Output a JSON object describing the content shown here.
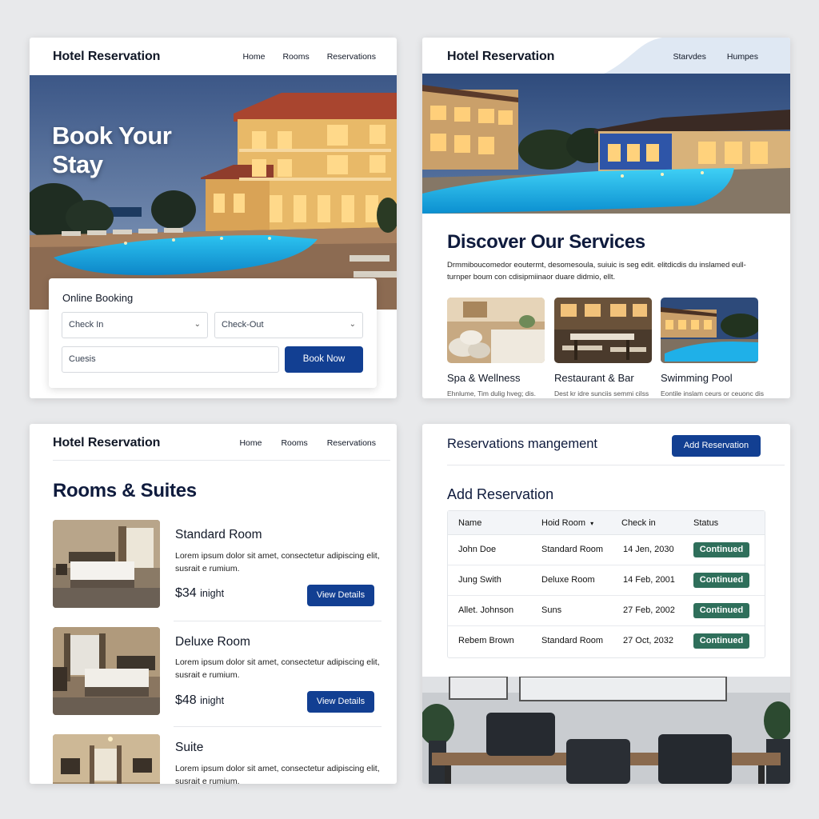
{
  "panel1": {
    "brand": "Hotel Reservation",
    "nav": [
      "Home",
      "Rooms",
      "Reservations"
    ],
    "hero_title_line1": "Book Your",
    "hero_title_line2": "Stay",
    "booking": {
      "title": "Online Booking",
      "check_in": "Check In",
      "check_out": "Check-Out",
      "guests_placeholder": "Cuesis",
      "button": "Book Now"
    }
  },
  "panel2": {
    "brand": "Hotel Reservation",
    "nav": [
      "Starvdes",
      "Humpes"
    ],
    "title": "Discover Our Services",
    "desc": "Drmmiboucomedor eoutermt, desomesoula, suiuic is seg edit. elitdicdis du inslamed eull-turnper boum con cdisipmiinaor duare didmio, ellt.",
    "services": [
      {
        "name": "Spa & Wellness",
        "sub": "Ehnlume, Tim dulig hveg; dis."
      },
      {
        "name": "Restaurant & Bar",
        "sub": "Dest kr idre sunciis semmi cilss"
      },
      {
        "name": "Swimming Pool",
        "sub": "Eontile inslam ceurs or ceuonc dis"
      }
    ]
  },
  "panel3": {
    "brand": "Hotel Reservation",
    "nav": [
      "Home",
      "Rooms",
      "Reservations"
    ],
    "title": "Rooms & Suites",
    "rooms": [
      {
        "name": "Standard Room",
        "desc": "Lorem ipsum dolor sit amet, consectetur adipiscing elit, susrait e rumium.",
        "price": "$34",
        "unit": "inight",
        "button": "View Details"
      },
      {
        "name": "Deluxe Room",
        "desc": "Lorem ipsum dolor sit amet, consectetur adipiscing elit, susrait e rumium.",
        "price": "$48",
        "unit": "inight",
        "button": "View Details"
      },
      {
        "name": "Suite",
        "desc": "Lorem ipsum dolor sit amet, consectetur adipiscing elit, susrait e rumium."
      }
    ]
  },
  "panel4": {
    "title": "Reservations mangement",
    "add_button": "Add Reservation",
    "section_title": "Add Reservation",
    "columns": [
      "Name",
      "Hoid Room",
      "Check in",
      "Status"
    ],
    "rows": [
      {
        "name": "John Doe",
        "room": "Standard Room",
        "check_in": "14 Jen, 2030",
        "status": "Continued"
      },
      {
        "name": "Jung Swith",
        "room": "Deluxe Room",
        "check_in": "14 Feb, 2001",
        "status": "Continued"
      },
      {
        "name": "Allet. Johnson",
        "room": "Suns",
        "check_in": "27 Feb, 2002",
        "status": "Continued"
      },
      {
        "name": "Rebem Brown",
        "room": "Standard Room",
        "check_in": "27 Oct, 2032",
        "status": "Continued"
      }
    ]
  },
  "colors": {
    "primary_button": "#123f92",
    "status_badge": "#2f6f5b",
    "heading": "#0f1b3d",
    "pool": "#1fb0e0"
  }
}
